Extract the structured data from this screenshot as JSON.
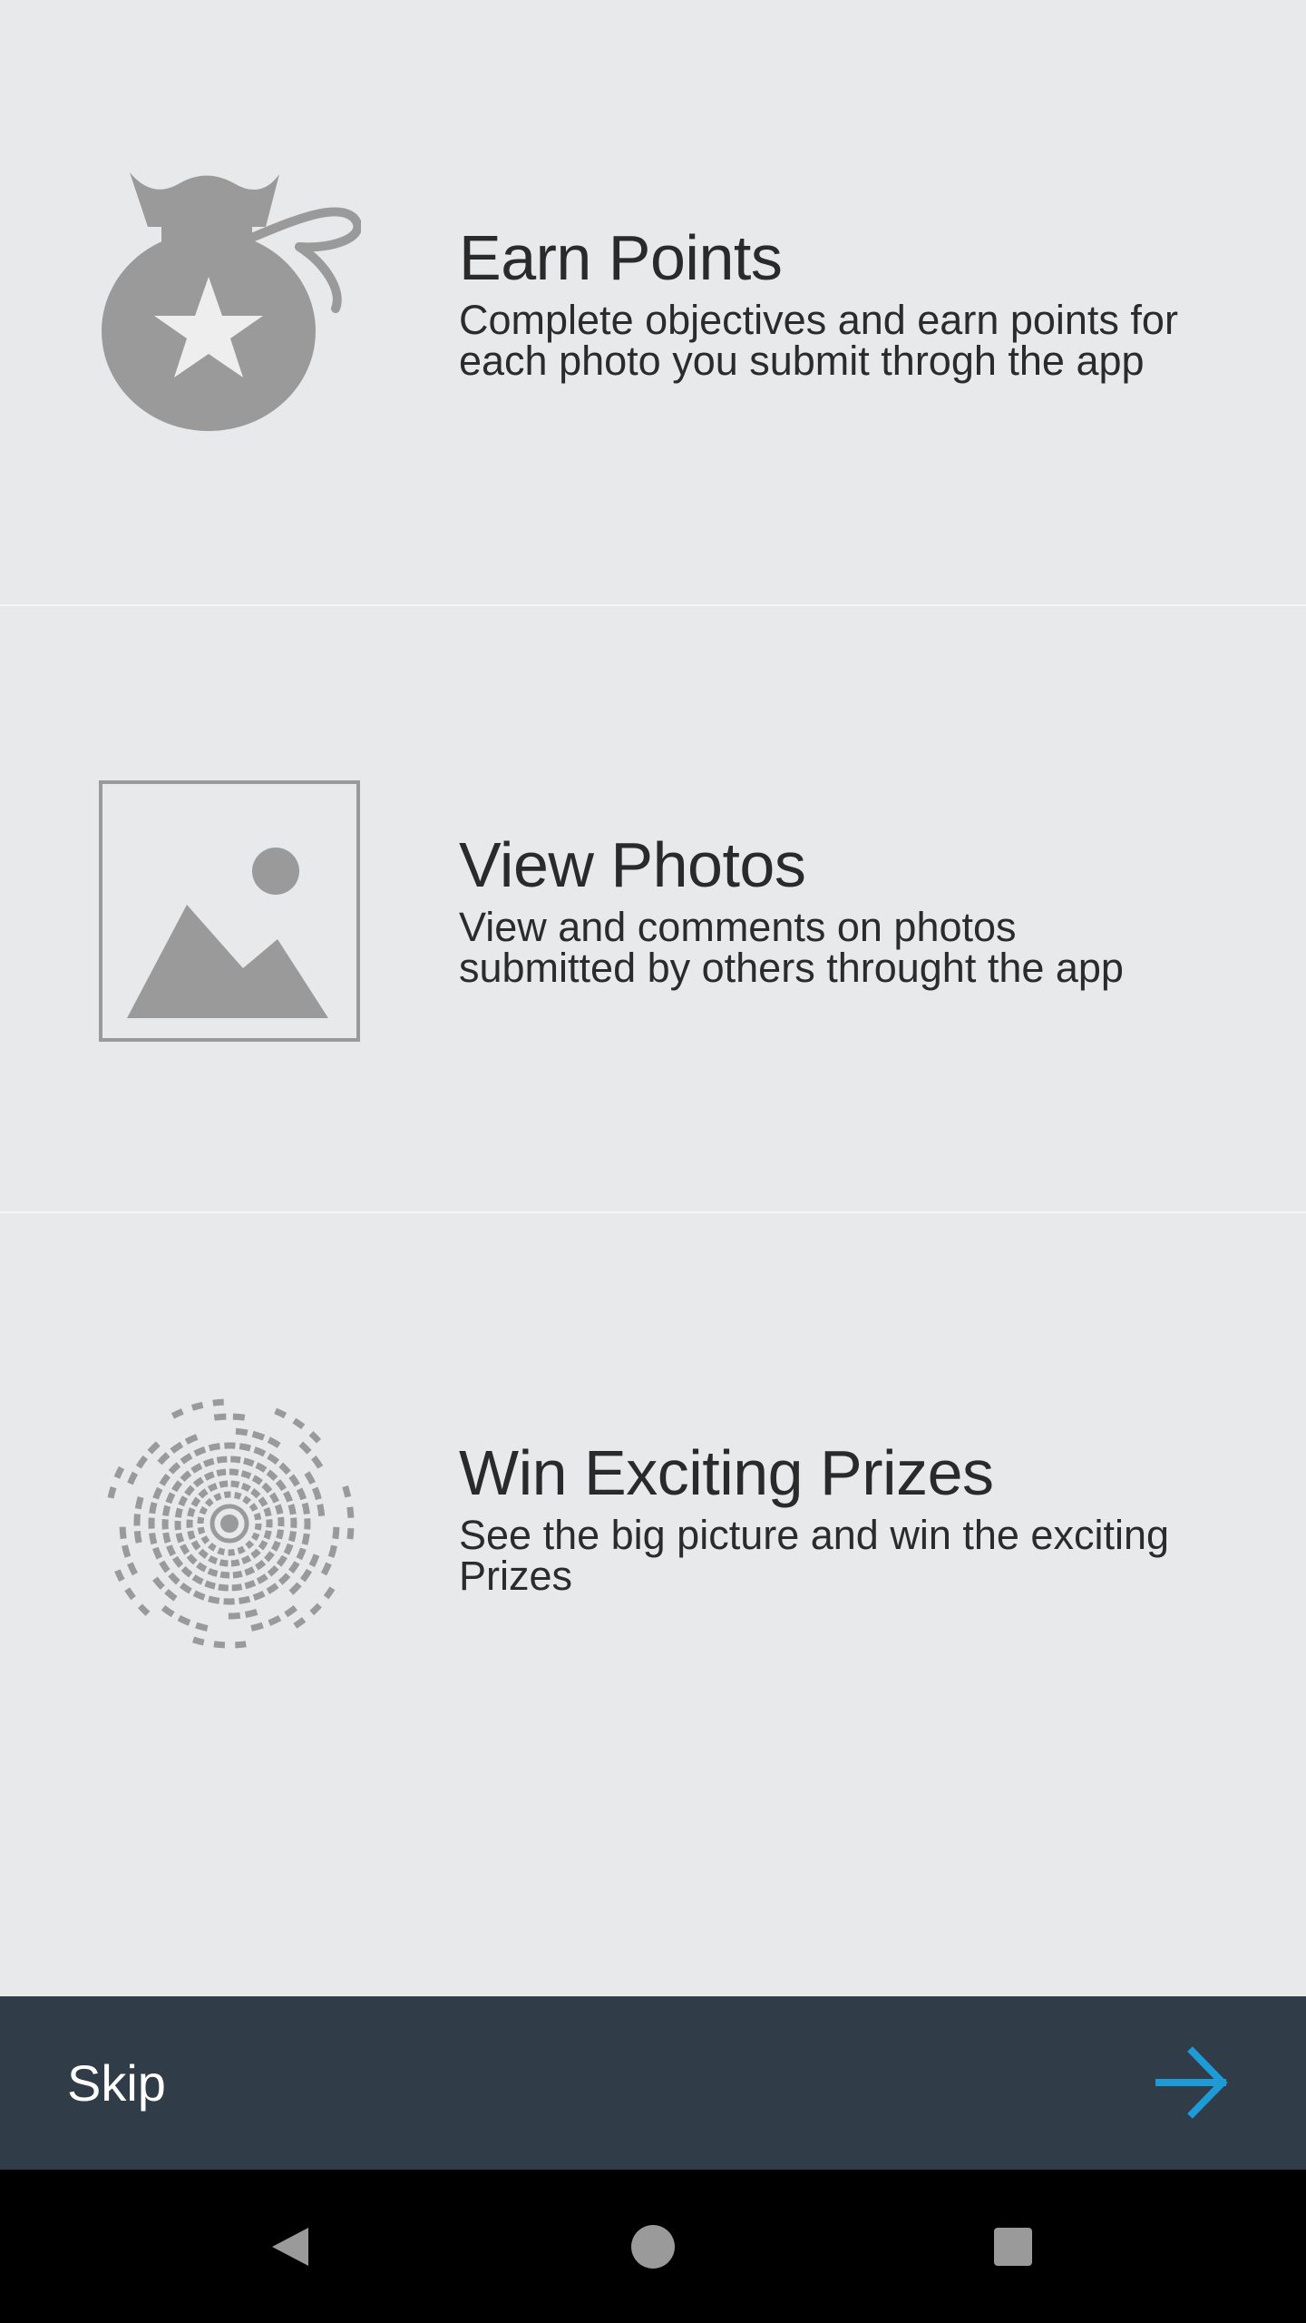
{
  "features": [
    {
      "title": "Earn Points",
      "description_line1": "Complete objectives and earn points for",
      "description_line2": "each photo you submit throgh the app",
      "icon": "money-bag-star-icon"
    },
    {
      "title": "View Photos",
      "description_line1": "View and comments on photos",
      "description_line2": "submitted by others throught the app",
      "icon": "image-placeholder-icon"
    },
    {
      "title": "Win Exciting Prizes",
      "description_line1": "See the big picture and win the exciting",
      "description_line2": "Prizes",
      "icon": "radial-burst-icon"
    }
  ],
  "footer": {
    "skip_label": "Skip",
    "next_icon": "arrow-right-icon"
  },
  "system_nav": {
    "back_icon": "back-triangle-icon",
    "home_icon": "home-circle-icon",
    "recents_icon": "recents-square-icon"
  },
  "colors": {
    "background": "#e8e9eb",
    "icon_gray": "#9a9a9a",
    "footer_bg": "#313c49",
    "accent_blue": "#1e9ad6",
    "text_dark": "#2a2a2a"
  }
}
